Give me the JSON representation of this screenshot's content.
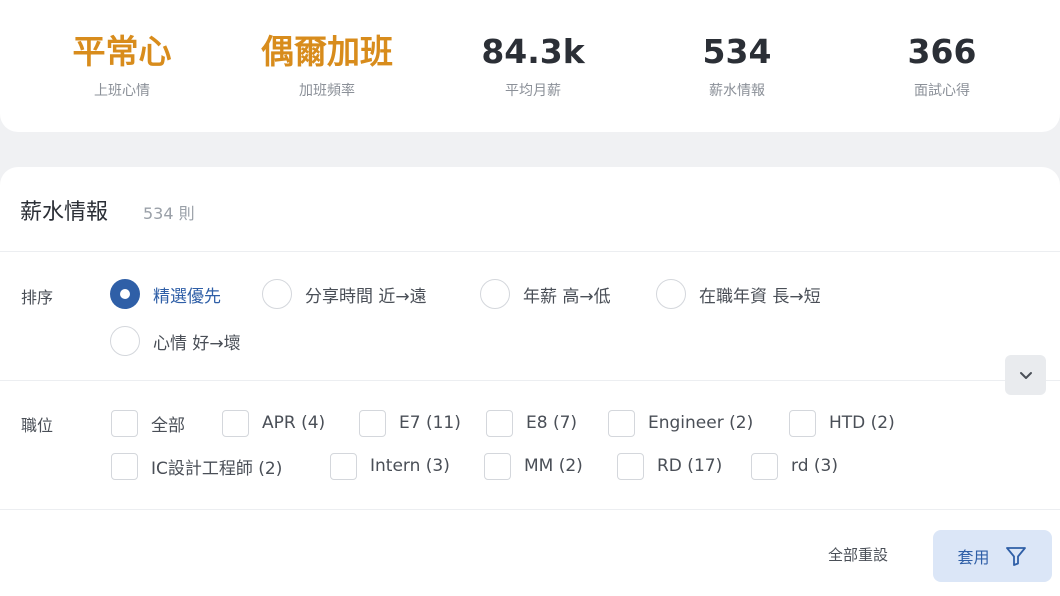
{
  "stats": [
    {
      "value": "平常心",
      "label": "上班心情",
      "accent": true
    },
    {
      "value": "偶爾加班",
      "label": "加班頻率",
      "accent": true
    },
    {
      "value": "84.3k",
      "label": "平均月薪",
      "accent": false
    },
    {
      "value": "534",
      "label": "薪水情報",
      "accent": false
    },
    {
      "value": "366",
      "label": "面試心得",
      "accent": false
    }
  ],
  "panel": {
    "title": "薪水情報",
    "count": "534 則"
  },
  "sort": {
    "label": "排序",
    "options": [
      {
        "label": "精選優先",
        "selected": true
      },
      {
        "label": "分享時間 近→遠",
        "selected": false
      },
      {
        "label": "年薪 高→低",
        "selected": false
      },
      {
        "label": "在職年資 長→短",
        "selected": false
      },
      {
        "label": "心情 好→壞",
        "selected": false
      }
    ]
  },
  "position": {
    "label": "職位",
    "options": [
      {
        "label": "全部",
        "checked": false
      },
      {
        "label": "APR (4)",
        "checked": false
      },
      {
        "label": "E7 (11)",
        "checked": false
      },
      {
        "label": "E8 (7)",
        "checked": false
      },
      {
        "label": "Engineer (2)",
        "checked": false
      },
      {
        "label": "HTD (2)",
        "checked": false
      },
      {
        "label": "IC設計工程師 (2)",
        "checked": false
      },
      {
        "label": "Intern (3)",
        "checked": false
      },
      {
        "label": "MM (2)",
        "checked": false
      },
      {
        "label": "RD (17)",
        "checked": false
      },
      {
        "label": "rd (3)",
        "checked": false
      }
    ],
    "expand_icon": "chevron-down-icon"
  },
  "actions": {
    "reset_label": "全部重設",
    "apply_label": "套用",
    "apply_icon": "filter-icon"
  },
  "colors": {
    "accent": "#d88c1c",
    "primary": "#2f5fa7",
    "apply_bg": "#dbe6f7"
  }
}
